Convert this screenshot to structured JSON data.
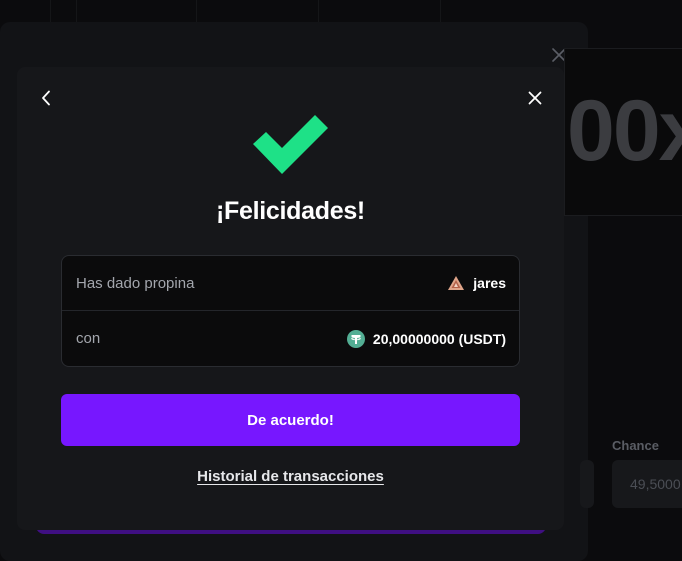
{
  "background": {
    "multiplier_text": "00x",
    "chance_label": "Chance",
    "chance_value": "49,5000"
  },
  "modal": {
    "title": "¡Felicidades!",
    "tip_label": "Has dado propina",
    "recipient": "jares",
    "amount_label": "con",
    "amount_value": "20,00000000 (USDT)",
    "ok_button": "De acuerdo!",
    "history_link": "Historial de transacciones"
  },
  "icons": {
    "back": "chevron-left-icon",
    "close": "close-icon",
    "success": "checkmark-icon",
    "user": "user-rank-icon",
    "currency": "tether-icon"
  },
  "colors": {
    "accent": "#7717ff",
    "success": "#1ee187",
    "tether": "#53ae94",
    "modal_bg": "#16171a"
  }
}
